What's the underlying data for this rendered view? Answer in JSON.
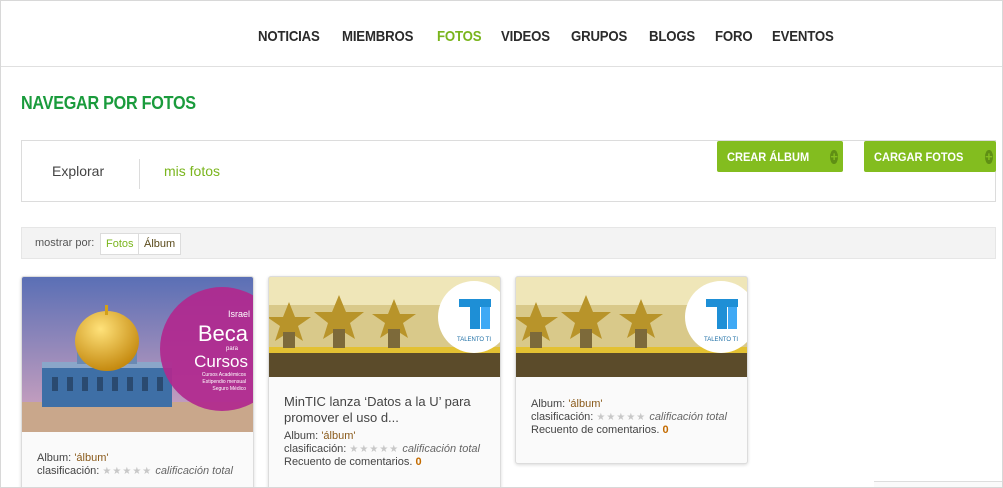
{
  "nav": {
    "items": [
      {
        "label": "NOTICIAS",
        "active": false
      },
      {
        "label": "MIEMBROS",
        "active": false
      },
      {
        "label": "FOTOS",
        "active": true
      },
      {
        "label": "VIDEOS",
        "active": false
      },
      {
        "label": "GRUPOS",
        "active": false
      },
      {
        "label": "BLOGS",
        "active": false
      },
      {
        "label": "FORO",
        "active": false
      },
      {
        "label": "EVENTOS",
        "active": false
      }
    ]
  },
  "page": {
    "title": "NAVEGAR POR FOTOS"
  },
  "tabs": {
    "explore": "Explorar",
    "mine": "mis fotos"
  },
  "buttons": {
    "create_album": "CREAR ÁLBUM",
    "upload_photos": "CARGAR FOTOS"
  },
  "show_by": {
    "label": "mostrar por:",
    "options": [
      "Fotos",
      "Álbum"
    ],
    "selected": "Fotos"
  },
  "image_texts": {
    "israel": "Israel",
    "beca": "Beca",
    "para": "para",
    "cursos": "Cursos",
    "line1": "Cursos Académicos",
    "line2": "Estipendio mensual",
    "line3": "Seguro Médico",
    "talento": "TALENTO TI"
  },
  "cards": [
    {
      "caption": "",
      "album_label": "Album:",
      "album_name": "'álbum'",
      "rating_label": "clasificación:",
      "rating_text": "calificación total",
      "comments_label": "",
      "comments": ""
    },
    {
      "caption": "MinTIC lanza ‘Datos a la U’ para promover el uso d...",
      "album_label": "Album:",
      "album_name": "'álbum'",
      "rating_label": "clasificación:",
      "rating_text": "calificación total",
      "comments_label": "Recuento de comentarios.",
      "comments": "0"
    },
    {
      "caption": "",
      "album_label": "Album:",
      "album_name": "'álbum'",
      "rating_label": "clasificación:",
      "rating_text": "calificación total",
      "comments_label": "Recuento de comentarios.",
      "comments": "0"
    }
  ],
  "colors": {
    "accent_green": "#7ab51d",
    "title_green": "#1a9b3c",
    "button_green": "#83bd1f",
    "count_orange": "#c36b00"
  }
}
